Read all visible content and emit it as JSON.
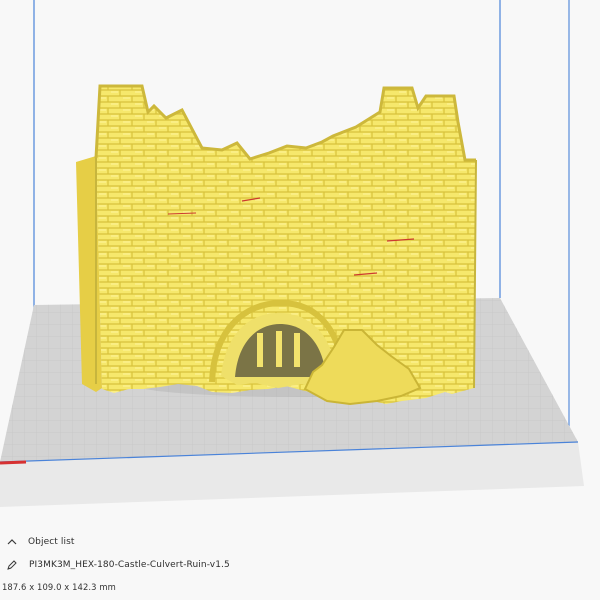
{
  "object_list": {
    "header_label": "Object list",
    "object_name": "PI3MK3M_HEX-180-Castle-Culvert-Ruin-v1.5",
    "dimensions": "187.6 x 109.0 x 142.3 mm"
  },
  "icons": {
    "collapse": "chevron-up-icon",
    "edit": "pencil-icon"
  },
  "colors": {
    "model": "#f5e86a",
    "model_shadow": "#e0cb3d",
    "build_plate": "#d6d6d6",
    "build_volume_line": "#4a83d9",
    "background": "#f8f8f8",
    "text": "#2e2e2e"
  }
}
